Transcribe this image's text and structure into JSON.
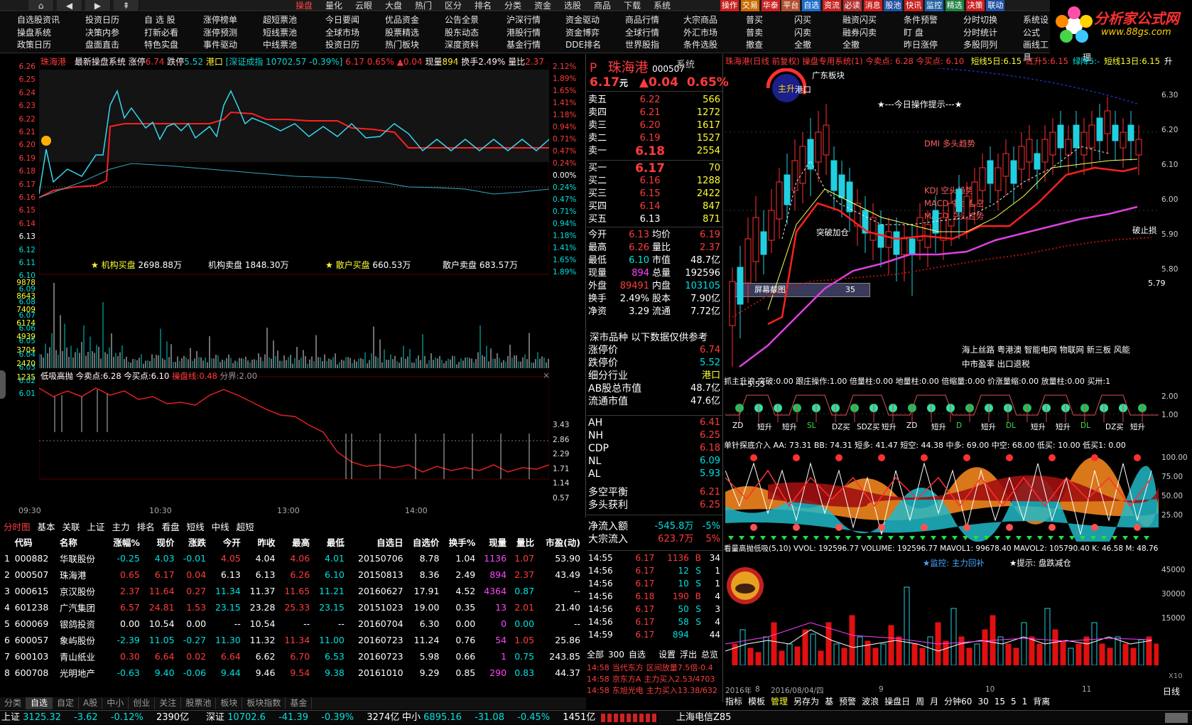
{
  "menubar": {
    "items": [
      "操盘",
      "量化",
      "云眼",
      "大盘",
      "热门",
      "区分",
      "排名",
      "分类",
      "资金",
      "选股",
      "商品",
      "下载",
      "系统"
    ],
    "active": "操盘",
    "right_tabs": [
      "操作",
      "交易",
      "华泰",
      "平台",
      "自选",
      "资流",
      "必读",
      "消息",
      "股池",
      "快讯",
      "监控",
      "精选",
      "决策",
      "联动"
    ]
  },
  "quicknav": {
    "col1": [
      "自选股资讯",
      "操盘系统",
      "政策日历"
    ],
    "col2": [
      "投资日历",
      "决策内参",
      "盘面直击"
    ],
    "col3": [
      "自 选 股",
      "打新必看",
      "特色实盘"
    ],
    "col4": [
      "涨停榜单",
      "涨停预测",
      "事件驱动"
    ],
    "col5": [
      "超短票池",
      "短线票池",
      "中线票池"
    ],
    "col6": [
      "今日要闻",
      "全球市场",
      "投资日历"
    ],
    "col7": [
      "优品资金",
      "股票精选",
      "热门板块"
    ],
    "col8": [
      "公告全景",
      "股东动态",
      "深度资料"
    ],
    "col9": [
      "沪深行情",
      "港股行情",
      "基金行情"
    ],
    "col10": [
      "资金驱动",
      "资金博弈",
      "DDE排名"
    ],
    "col11": [
      "商品行情",
      "全球行情",
      "世界股指"
    ],
    "col12": [
      "大宗商品",
      "外汇市场",
      "条件选股"
    ],
    "col13": [
      "普买",
      "普卖",
      "撤查"
    ],
    "col14": [
      "闪买",
      "闪卖",
      "全撤"
    ],
    "col15": [
      "融资闪买",
      "融券闪卖",
      "全撤"
    ],
    "col16": [
      "条件预警",
      "盯 盘",
      "昨日涨停"
    ],
    "col17": [
      "分时切换",
      "分时统计",
      "多股同列"
    ],
    "col18": [
      "系统设",
      "公式",
      "画线工具"
    ],
    "col19": [
      "数据管理"
    ]
  },
  "logo": {
    "text": "分析家公式网",
    "url": "www.88gs.com"
  },
  "intraday": {
    "title": "珠海港",
    "system": "最新操盘系统",
    "limit_up_label": "涨停",
    "limit_up": "6.74",
    "limit_down_label": "跌停",
    "limit_down": "5.52",
    "sector": "港口",
    "index_info": "[深证成指 10702.57 -0.39%]",
    "price": "6.17",
    "pct": "0.65%",
    "chg": "0.04",
    "vol_label": "现量",
    "vol": "894",
    "turn_label": "换手",
    "turn": "2.49%",
    "ratio_label": "量比",
    "ratio": "2.37",
    "price_scale": [
      "6.26",
      "6.25",
      "6.24",
      "6.23",
      "6.22",
      "6.21",
      "6.20",
      "6.19",
      "6.18",
      "6.17",
      "6.16",
      "6.15",
      "6.14",
      "6.13",
      "6.12",
      "6.11",
      "6.10",
      "6.09",
      "6.08",
      "6.07",
      "6.06",
      "6.05",
      "6.04",
      "6.03",
      "6.02",
      "6.01"
    ],
    "pct_scale": [
      "2.12%",
      "1.89%",
      "1.65%",
      "1.41%",
      "1.18%",
      "0.94%",
      "0.71%",
      "0.47%",
      "0.24%",
      "0.00%",
      "0.24%",
      "0.47%",
      "0.71%",
      "0.94%",
      "1.18%",
      "1.41%",
      "1.65%",
      "1.89%"
    ],
    "flow": [
      {
        "label": "★ 机构买盘",
        "value": "2698.88万"
      },
      {
        "label": "机构卖盘",
        "value": "1848.30万"
      },
      {
        "label": "★ 散户买盘",
        "value": "660.53万"
      },
      {
        "label": "散户卖盘",
        "value": "683.57万"
      }
    ],
    "vol_scale": [
      "9878",
      "8643",
      "7409",
      "6174",
      "4939",
      "3704",
      "2470",
      "1235"
    ],
    "ind_header": {
      "name": "低吸高抛",
      "sell_label": "今卖点:",
      "sell": "6.28",
      "buy_label": "今买点:",
      "buy": "6.10",
      "line_label": "操盘线:",
      "line": "0.48",
      "boundary_label": "分界:",
      "boundary": "2.00"
    },
    "ind_scale": [
      "3.43",
      "2.86",
      "2.29",
      "1.71",
      "1.14",
      "0.57"
    ],
    "times": [
      "09:30",
      "10:30",
      "13:00",
      "14:00"
    ]
  },
  "quote": {
    "code_prefix": "P",
    "name": "珠海港",
    "code": "000507",
    "price": "6.17",
    "unit": "元",
    "chg": "▲0.04",
    "pct": "0.65%",
    "system": "系统",
    "asks": [
      {
        "label": "卖五",
        "price": "6.22",
        "vol": "566"
      },
      {
        "label": "卖四",
        "price": "6.21",
        "vol": "1272"
      },
      {
        "label": "卖三",
        "price": "6.20",
        "vol": "1617"
      },
      {
        "label": "卖二",
        "price": "6.19",
        "vol": "1527"
      },
      {
        "label": "卖一",
        "price": "6.18",
        "vol": "2554"
      }
    ],
    "bids": [
      {
        "label": "买一",
        "price": "6.17",
        "vol": "70"
      },
      {
        "label": "买二",
        "price": "6.16",
        "vol": "1288"
      },
      {
        "label": "买三",
        "price": "6.15",
        "vol": "2422"
      },
      {
        "label": "买四",
        "price": "6.14",
        "vol": "847"
      },
      {
        "label": "买五",
        "price": "6.13",
        "vol": "871"
      }
    ],
    "stats": [
      [
        "今开",
        "6.13",
        "均价",
        "6.19"
      ],
      [
        "最高",
        "6.26",
        "量比",
        "2.37"
      ],
      [
        "最低",
        "6.10",
        "市值",
        "48.7亿"
      ],
      [
        "现量",
        "894",
        "总量",
        "192596"
      ],
      [
        "外盘",
        "89491",
        "内盘",
        "103105"
      ],
      [
        "换手",
        "2.49%",
        "股本",
        "7.90亿"
      ],
      [
        "净资",
        "3.29",
        "流通",
        "7.72亿"
      ]
    ],
    "notice": "深市品种 以下数据仅供参考",
    "limits": [
      [
        "涨停价",
        "6.74"
      ],
      [
        "跌停价",
        "5.52"
      ],
      [
        "细分行业",
        "港口"
      ],
      [
        "AB股总市值",
        "48.7亿"
      ],
      [
        "流通市值",
        "47.6亿"
      ]
    ],
    "indicators": [
      [
        "AH",
        "6.41"
      ],
      [
        "NH",
        "6.25"
      ],
      [
        "CDP",
        "6.18"
      ],
      [
        "NL",
        "6.09"
      ],
      [
        "AL",
        "5.93"
      ]
    ],
    "balance": [
      [
        "多空平衡",
        "6.21"
      ],
      [
        "多头获利",
        "6.25"
      ]
    ],
    "netflow": [
      [
        "净流入额",
        "-545.8万",
        "-5%"
      ],
      [
        "大宗流入",
        "623.7万",
        "5%"
      ]
    ],
    "ticks": [
      [
        "14:55",
        "6.17",
        "1136",
        "B",
        "34"
      ],
      [
        "14:56",
        "6.17",
        "12",
        "S",
        "1"
      ],
      [
        "14:56",
        "6.17",
        "10",
        "S",
        "1"
      ],
      [
        "14:56",
        "6.18",
        "190",
        "B",
        "4"
      ],
      [
        "14:56",
        "6.17",
        "50",
        "S",
        "3"
      ],
      [
        "14:56",
        "6.17",
        "58",
        "S",
        "4"
      ],
      [
        "14:59",
        "6.17",
        "894",
        "",
        " 44"
      ]
    ],
    "bottom_tabs": [
      "全部",
      "300",
      "自选",
      "设置",
      "浮出",
      "总览"
    ],
    "news": [
      [
        "14:58",
        "当代东方",
        "区间放量7.5倍-0.4"
      ],
      [
        "14:58",
        "京东方A",
        "主力买入2.53/4703"
      ],
      [
        "14:58",
        "东旭光电",
        "主力买入13.38/632"
      ]
    ]
  },
  "kline": {
    "header": "珠海港(日线 前复权) 操盘专用系统(1) 今卖点: 6.28 今买点: 6.10",
    "ma_labels": [
      [
        "短线5日:",
        "6.15"
      ],
      [
        "红升5:",
        "6.15"
      ],
      [
        "绿降5:",
        "-"
      ],
      [
        "短线13日:",
        "6.15"
      ],
      [
        "升",
        ""
      ]
    ],
    "sector": "广东板块",
    "sector2": "港口",
    "tip": "★---今日操作提示---★",
    "dmi": "DMI 多头趋势",
    "kdj": "KDJ 空头趋势",
    "macd1": "MACD 中线看空",
    "macd2": "MACD 空头趋势",
    "breakout": "突破加仓",
    "breakstop": "破止损",
    "screenshot": "屏幕截图",
    "screenshot_num": "35",
    "low_label": "←5.53",
    "right_val": "5.79",
    "concepts1": "海上丝路 粤港澳 智能电网 物联网 新三板 风能",
    "concepts2": "中市盈率 出口退税",
    "scale": [
      "6.30",
      "6.20",
      "6.10",
      "6.00",
      "5.90",
      "5.80"
    ],
    "sub1_header": "抓主升浪 突破:0.00 跟庄操作:1.00 倍量柱:0.00 地量柱:0.00 倍缩量:0.00 价涨量缩:0.00 放量柱:0.00 买卅:1",
    "sub1_scale": [
      "2.00",
      "1.00"
    ],
    "sub1_labels": [
      "ZD",
      "短升",
      "短升",
      "SL",
      "DZ买",
      "SDZ买",
      "短升",
      "ZD",
      "短升",
      "D",
      "短升",
      "DL",
      "短升",
      "短升",
      "DL",
      "DZ买",
      "短升"
    ],
    "sub2_header": "单针探底介入 AA: 73.31 BB: 74.31 短多: 41.47 短空: 44.38 中多: 69.00 中空: 68.00 低买: 10.00 低买1: 0.00",
    "sub2_scale": [
      "100.00",
      "75.00",
      "50.00",
      "25.00"
    ],
    "sub3_header": "看量高抛低吸(5,10) VVOL: 192596.77 VOLUME: 192596.77 MAVOL1: 99678.40 MAVOL2: 105790.40 K: 46.58 M: 48.76",
    "sub3_tip1": "★监控: 主力回补",
    "sub3_tip2": "★提示: 盘跌减仓",
    "sub3_scale": [
      "45000",
      "30000",
      "15000"
    ],
    "sub3_unit": "X10",
    "date_labels": [
      "2016年",
      "8",
      "2016/08/04/四",
      "9",
      "10",
      "11"
    ],
    "periods": [
      "指标",
      "模板",
      "管理",
      "另存为",
      "基",
      "预警",
      "波浪",
      "操盘日",
      "周",
      "月",
      "分钟60",
      "30",
      "15",
      "5",
      "1",
      "背离"
    ],
    "day_label": "日线"
  },
  "table": {
    "tabs": [
      "分时图",
      "基本",
      "关联",
      "上证",
      "主力",
      "排名",
      "看盘",
      "短线",
      "中线",
      "超短"
    ],
    "headers": [
      "",
      "代码",
      "名称",
      "涨幅%",
      "现价",
      "涨跌",
      "今开",
      "昨收",
      "最高",
      "最低",
      "自选日",
      "自选价",
      "换手%",
      "现量",
      "量比",
      "市盈(动)"
    ],
    "rows": [
      [
        "1",
        "000882",
        "华联股份",
        "-0.25",
        "4.03",
        "-0.01",
        "4.05",
        "4.04",
        "4.06",
        "4.01",
        "20150706",
        "8.78",
        "1.04",
        "1136",
        "1.07",
        "53.90"
      ],
      [
        "2",
        "000507",
        "珠海港",
        "0.65",
        "6.17",
        "0.04",
        "6.13",
        "6.13",
        "6.26",
        "6.10",
        "20150813",
        "8.36",
        "2.49",
        "894",
        "2.37",
        "43.49"
      ],
      [
        "3",
        "000615",
        "京汉股份",
        "2.37",
        "11.64",
        "0.27",
        "11.34",
        "11.37",
        "11.65",
        "11.21",
        "20160627",
        "17.91",
        "4.52",
        "4364",
        "0.87",
        "--"
      ],
      [
        "4",
        "601238",
        "广汽集团",
        "6.57",
        "24.81",
        "1.53",
        "23.15",
        "23.28",
        "25.33",
        "23.15",
        "20151023",
        "19.00",
        "0.35",
        "13",
        "2.01",
        "21.40"
      ],
      [
        "5",
        "600069",
        "银鸽投资",
        "0.00",
        "10.54",
        "0.00",
        "--",
        "10.54",
        "--",
        "--",
        "20160704",
        "6.30",
        "0.00",
        "0",
        "0.00",
        "--"
      ],
      [
        "6",
        "600057",
        "象屿股份",
        "-2.39",
        "11.05",
        "-0.27",
        "11.30",
        "11.32",
        "11.34",
        "11.00",
        "20160723",
        "11.24",
        "0.76",
        "54",
        "1.05",
        "25.86"
      ],
      [
        "7",
        "600103",
        "青山纸业",
        "0.30",
        "6.64",
        "0.02",
        "6.64",
        "6.62",
        "6.70",
        "6.53",
        "20160723",
        "5.98",
        "0.66",
        "1",
        "0.75",
        "243.85"
      ],
      [
        "8",
        "600708",
        "光明地产",
        "-0.63",
        "9.40",
        "-0.06",
        "9.44",
        "9.46",
        "9.54",
        "9.38",
        "20161010",
        "9.29",
        "0.85",
        "290",
        "0.83",
        "44.37"
      ]
    ],
    "row_colors": [
      "grn",
      "red",
      "red",
      "red",
      "wht",
      "grn",
      "red",
      "grn"
    ],
    "bottom_tabs": [
      "分类",
      "自选",
      "自定",
      "A股",
      "中小",
      "创业",
      "关注",
      "股票池",
      "板块",
      "板块指数",
      "基金"
    ]
  },
  "status": {
    "sh_label": "上证",
    "sh": "3125.32",
    "sh_chg": "-3.62",
    "sh_pct": "-0.12%",
    "sh_amt": "2390亿",
    "sz_label": "深证",
    "sz": "10702.6",
    "sz_chg": "-41.39",
    "sz_pct": "-0.39%",
    "sz_amt": "3274亿",
    "zx_label": "中小",
    "zx": "6895.16",
    "zx_chg": "-31.08",
    "zx_pct": "-0.45%",
    "zx_amt": "1451亿",
    "server": "上海电信Z85"
  },
  "colors": {
    "up": "#ff3c3c",
    "down": "#00e0e0",
    "accent": "#ffff33"
  }
}
